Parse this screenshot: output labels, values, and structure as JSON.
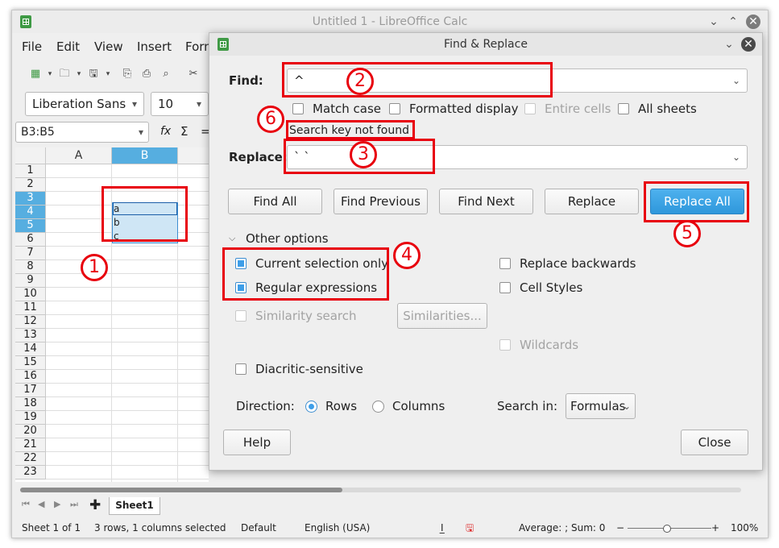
{
  "calc": {
    "window_title": "Untitled 1 - LibreOffice Calc",
    "menu": [
      "File",
      "Edit",
      "View",
      "Insert",
      "Form"
    ],
    "font_name": "Liberation Sans",
    "font_size": "10",
    "name_box": "B3:B5",
    "formula_icons": [
      "fx",
      "Σ",
      "="
    ],
    "columns": [
      "A",
      "B"
    ],
    "rows": [
      "1",
      "2",
      "3",
      "4",
      "5",
      "6",
      "7",
      "8",
      "9",
      "10",
      "11",
      "12",
      "13",
      "14",
      "15",
      "16",
      "17",
      "18",
      "19",
      "20",
      "21",
      "22",
      "23"
    ],
    "cells": [
      "a",
      "b",
      "c"
    ],
    "sheet_tab": "Sheet1",
    "status": {
      "sheet": "Sheet 1 of 1",
      "selection": "3 rows, 1 columns selected",
      "style": "Default",
      "language": "English (USA)",
      "sum": "Average: ; Sum: 0",
      "zoom": "100%"
    }
  },
  "dialog": {
    "title": "Find & Replace",
    "find_label": "Find:",
    "find_value": "^",
    "match_case": "Match case",
    "formatted_display": "Formatted display",
    "entire_cells": "Entire cells",
    "all_sheets": "All sheets",
    "search_status": "Search key not found",
    "replace_label": "Replace:",
    "replace_value": "` `",
    "buttons": {
      "find_all": "Find All",
      "find_previous": "Find Previous",
      "find_next": "Find Next",
      "replace": "Replace",
      "replace_all": "Replace All",
      "similarities": "Similarities...",
      "help": "Help",
      "close": "Close"
    },
    "other_options": "Other options",
    "current_selection_only": "Current selection only",
    "regular_expressions": "Regular expressions",
    "replace_backwards": "Replace backwards",
    "cell_styles": "Cell Styles",
    "similarity_search": "Similarity search",
    "wildcards": "Wildcards",
    "diacritic_sensitive": "Diacritic-sensitive",
    "direction_label": "Direction:",
    "rows_option": "Rows",
    "columns_option": "Columns",
    "search_in_label": "Search in:",
    "search_in_value": "Formulas"
  },
  "annotations": [
    "1",
    "2",
    "3",
    "4",
    "5",
    "6"
  ],
  "colors": {
    "annotation": "#e8000d",
    "selection": "#56aee0",
    "primary_button": "#2e97db"
  }
}
